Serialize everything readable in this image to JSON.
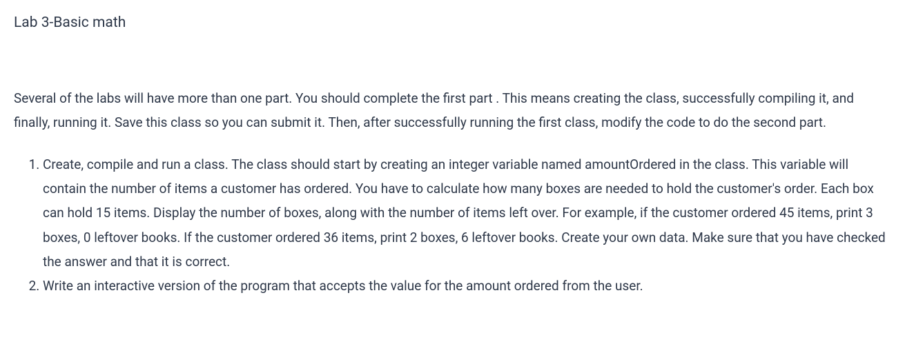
{
  "title": "Lab 3-Basic math",
  "intro": "Several of the labs will have more than one part.  You should complete the first part .  This means creating the class, successfully compiling it, and finally, running it.  Save this class so you can submit it.  Then, after successfully running the first class, modify the code to do the second part.",
  "items": [
    "Create, compile and run a class. The class should start by creating an integer variable named amountOrdered in the class.  This variable will contain the number of items a customer has ordered.  You have to calculate how many boxes are needed to hold the customer's order.  Each box can hold 15 items.  Display the number of boxes, along with the number of items left over.  For example, if the customer ordered 45 items, print 3 boxes, 0 leftover books.  If the customer ordered 36 items, print 2 boxes, 6 leftover books.  Create your own data.  Make sure that you have checked the answer and that it is correct.",
    "Write an interactive version of the program that accepts the value for the amount ordered from the user."
  ]
}
